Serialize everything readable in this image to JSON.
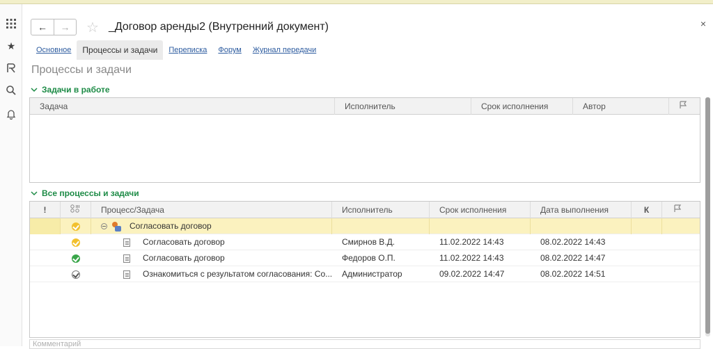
{
  "window": {
    "title": "_Договор аренды2 (Внутренний документ)",
    "close_glyph": "×"
  },
  "nav": {
    "back_glyph": "←",
    "forward_glyph": "→",
    "star_glyph": "☆"
  },
  "leftbar_icons": [
    "apps-grid-icon",
    "favorites-star-icon",
    "history-icon",
    "search-icon",
    "bell-icon"
  ],
  "tabs": [
    {
      "label": "Основное",
      "active": false
    },
    {
      "label": "Процессы и задачи",
      "active": true
    },
    {
      "label": "Переписка",
      "active": false
    },
    {
      "label": "Форум",
      "active": false
    },
    {
      "label": "Журнал передачи",
      "active": false
    }
  ],
  "section_title": "Процессы и задачи",
  "tasks_group": {
    "title": "Задачи в работе",
    "columns": [
      "Задача",
      "Исполнитель",
      "Срок исполнения",
      "Автор"
    ]
  },
  "processes_group": {
    "title": "Все процессы и задачи",
    "columns": {
      "importance": "!",
      "process": "Процесс/Задача",
      "executor": "Исполнитель",
      "deadline": "Срок исполнения",
      "completed": "Дата выполнения",
      "k": "К"
    },
    "rows": [
      {
        "status": "yellow",
        "type": "process",
        "name": "Согласовать договор",
        "executor": "",
        "deadline": "",
        "completed": "",
        "selected": true
      },
      {
        "status": "yellow",
        "type": "task",
        "name": "Согласовать договор",
        "executor": "Смирнов В.Д.",
        "deadline": "11.02.2022 14:43",
        "completed": "08.02.2022 14:43",
        "selected": false
      },
      {
        "status": "green",
        "type": "task",
        "name": "Согласовать договор",
        "executor": "Федоров О.П.",
        "deadline": "11.02.2022 14:43",
        "completed": "08.02.2022 14:47",
        "selected": false
      },
      {
        "status": "gray",
        "type": "task",
        "name": "Ознакомиться с результатом согласования: Со...",
        "executor": "Администратор",
        "deadline": "09.02.2022 14:47",
        "completed": "08.02.2022 14:51",
        "selected": false
      }
    ]
  },
  "comment_placeholder": "Комментарий",
  "colors": {
    "accent_green": "#1d8b46",
    "link_blue": "#2c5b9f",
    "selected_row": "#fbf2bf"
  }
}
